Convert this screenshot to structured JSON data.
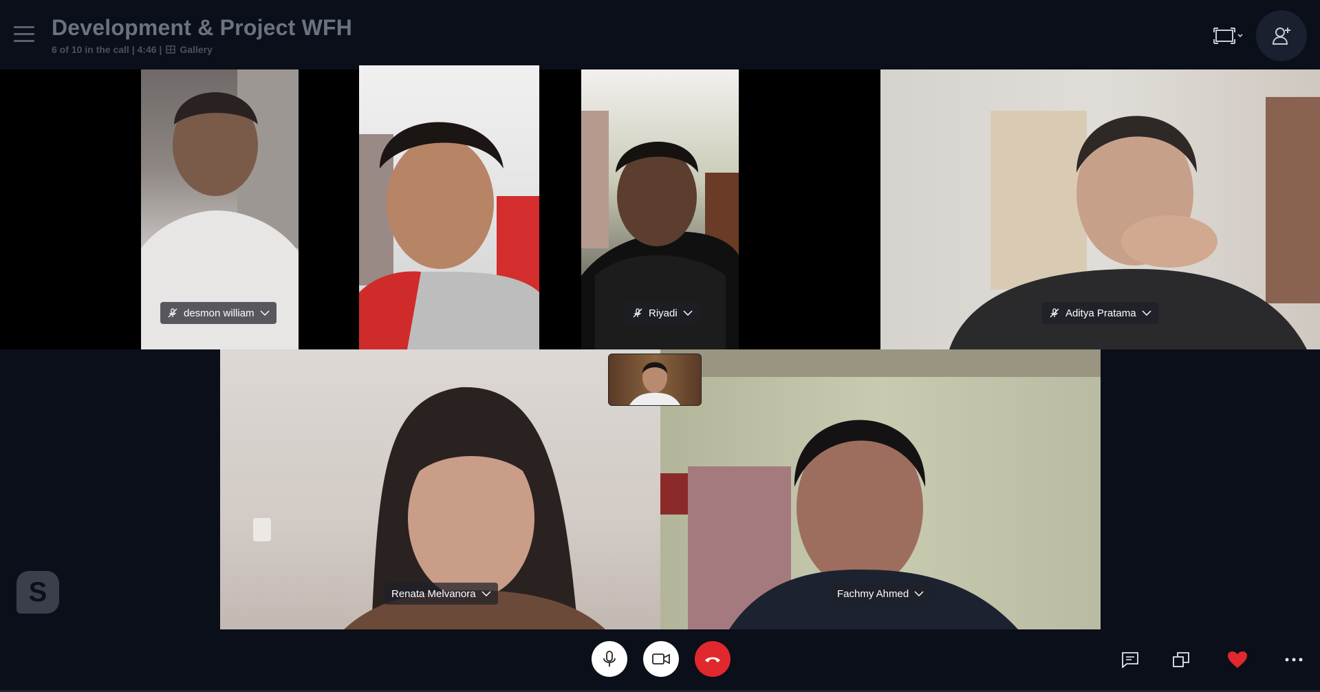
{
  "header": {
    "title": "Development & Project WFH",
    "call_status": "6 of 10 in the call | 4:46 |",
    "view_mode": "Gallery"
  },
  "participants": [
    {
      "name": "desmon william",
      "muted": true
    },
    {
      "name": "",
      "muted": false
    },
    {
      "name": "Riyadi",
      "muted": true
    },
    {
      "name": "Aditya Pratama",
      "muted": true
    },
    {
      "name": "Renata Melvanora",
      "muted": false
    },
    {
      "name": "Fachmy Ahmed",
      "muted": false
    }
  ],
  "controls": {
    "mic": "microphone-icon",
    "video": "video-camera-icon",
    "end_call": "hang-up-icon"
  },
  "side_actions": [
    "chat-icon",
    "window-switch-icon",
    "heart-react-icon",
    "more-options-icon"
  ],
  "colors": {
    "background": "#0b0f1a",
    "end_call": "#e0282e",
    "heart": "#e0282e"
  }
}
